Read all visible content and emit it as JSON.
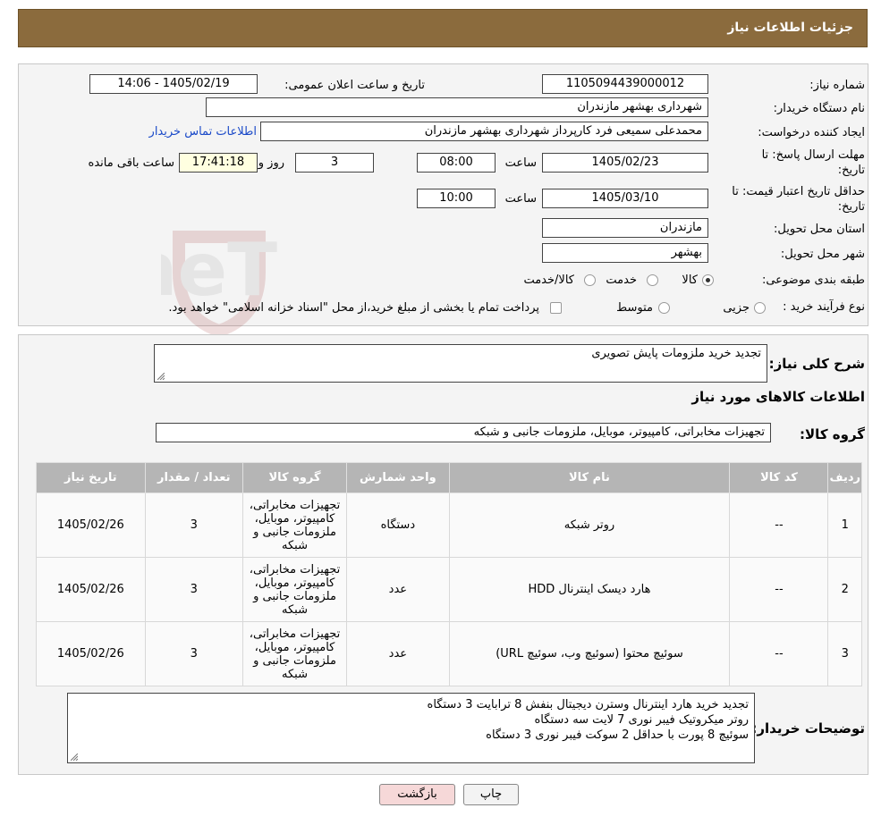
{
  "header": {
    "title": "جزئیات اطلاعات نیاز"
  },
  "form": {
    "need_number_label": "شماره نیاز:",
    "need_number": "1105094439000012",
    "announce_label": "تاریخ و ساعت اعلان عمومی:",
    "announce_value": "1405/02/19 - 14:06",
    "buyer_org_label": "نام دستگاه خریدار:",
    "buyer_org": "شهرداری بهشهر مازندران",
    "requester_label": "ایجاد کننده درخواست:",
    "requester": "محمدعلی سمیعی فرد کارپرداز شهرداری بهشهر مازندران",
    "contact_link": "اطلاعات تماس خریدار",
    "reply_deadline_label_1": "مهلت ارسال پاسخ: تا",
    "reply_deadline_label_2": "تاریخ:",
    "reply_date": "1405/02/23",
    "hour_label": "ساعت",
    "reply_time": "08:00",
    "days_value": "3",
    "days_label": "روز و",
    "remaining_time": "17:41:18",
    "remaining_label": "ساعت باقی مانده",
    "price_valid_label_1": "حداقل تاریخ اعتبار قیمت: تا",
    "price_valid_label_2": "تاریخ:",
    "price_valid_date": "1405/03/10",
    "price_valid_time": "10:00",
    "province_label": "استان محل تحویل:",
    "province": "مازندران",
    "city_label": "شهر محل تحویل:",
    "city": "بهشهر",
    "category_label": "طبقه بندی موضوعی:",
    "category_options": [
      "کالا",
      "خدمت",
      "کالا/خدمت"
    ],
    "purchase_type_label": "نوع فرآیند خرید :",
    "purchase_options": [
      "جزیی",
      "متوسط"
    ],
    "purchase_note": "پرداخت تمام یا بخشی از مبلغ خرید،از محل \"اسناد خزانه اسلامی\" خواهد بود."
  },
  "summary": {
    "description_label": "شرح کلی نیاز:",
    "description": "تجدید خرید ملزومات پایش تصویری",
    "goods_info_title": "اطلاعات کالاهای مورد نیاز",
    "goods_group_label": "گروه کالا:",
    "goods_group": "تجهیزات مخابراتی، کامپیوتر، موبایل، ملزومات جانبی و شبکه"
  },
  "table": {
    "headers": [
      "ردیف",
      "کد کالا",
      "نام کالا",
      "واحد شمارش",
      "گروه کالا",
      "تعداد / مقدار",
      "تاریخ نیاز"
    ],
    "rows": [
      [
        "1",
        "--",
        "روتر شبکه",
        "دستگاه",
        "تجهیزات مخابراتی، کامپیوتر، موبایل، ملزومات جانبی و شبکه",
        "3",
        "1405/02/26"
      ],
      [
        "2",
        "--",
        "هارد دیسک اینترنال HDD",
        "عدد",
        "تجهیزات مخابراتی، کامپیوتر، موبایل، ملزومات جانبی و شبکه",
        "3",
        "1405/02/26"
      ],
      [
        "3",
        "--",
        "سوئیچ محتوا (سوئیچ وب، سوئیچ URL)",
        "عدد",
        "تجهیزات مخابراتی، کامپیوتر، موبایل، ملزومات جانبی و شبکه",
        "3",
        "1405/02/26"
      ]
    ]
  },
  "buyer_notes": {
    "label": "توضیحات خریدار:",
    "lines": [
      "تجدید خرید هارد اینترنال وسترن دیجیتال بنفش 8 ترابایت 3 دستگاه",
      "روتر میکروتیک فیبر نوری 7 لایت سه دستگاه",
      "سوئیچ 8 پورت با حداقل 2 سوکت فیبر نوری 3 دستگاه"
    ]
  },
  "buttons": {
    "print": "چاپ",
    "back": "بازگشت"
  },
  "watermark": {
    "text": "AriaTender.neT"
  },
  "colors": {
    "header_bg": "#8b6b3d",
    "link": "#1a49c8",
    "back_button_bg": "#f6d8d8",
    "remaining_bg": "#ffffe0"
  }
}
